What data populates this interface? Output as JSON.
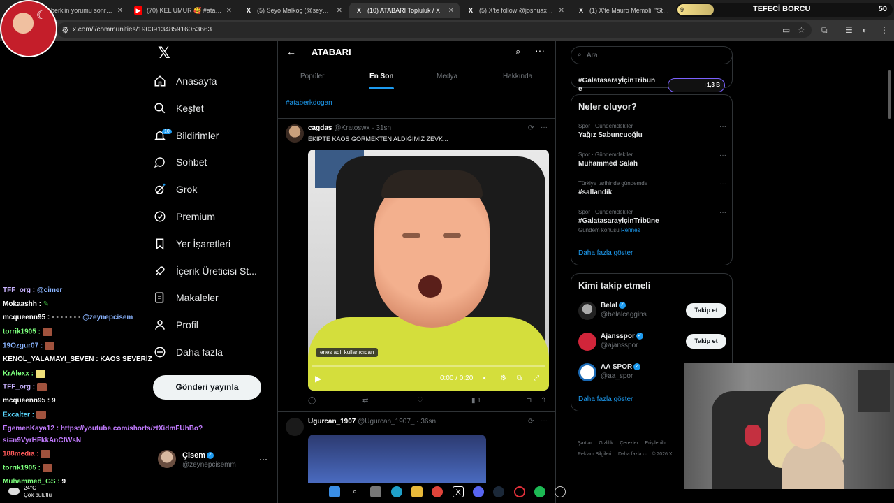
{
  "browser": {
    "tabs": [
      {
        "title": "aberk'in yorumu sonrası",
        "icon": "tab-favicon"
      },
      {
        "title": "(70) KEL UMUR 🥰 #ataberkdo",
        "icon": "youtube-icon"
      },
      {
        "title": "(5) Seyo Malkoç (@seyooo06) /",
        "icon": "x-icon"
      },
      {
        "title": "(10) ATABARI Topluluk / X",
        "icon": "x-icon"
      },
      {
        "title": "(5) X'te follow @joshuaxonsy: \"",
        "icon": "x-icon"
      },
      {
        "title": "(1) X'te Mauro Memoli: \"Star af",
        "icon": "x-icon"
      }
    ],
    "url": "x.com/i/communities/1903913485916053663"
  },
  "stream_overlay": {
    "goal_label": "TEFECİ BORCU",
    "goal_value": "50",
    "goal_pill": "9"
  },
  "nav": {
    "items": [
      {
        "label": "Anasayfa",
        "icon": "home-icon"
      },
      {
        "label": "Keşfet",
        "icon": "search-icon"
      },
      {
        "label": "Bildirimler",
        "icon": "bell-icon",
        "badge": "10"
      },
      {
        "label": "Sohbet",
        "icon": "chat-icon"
      },
      {
        "label": "Grok",
        "icon": "grok-icon"
      },
      {
        "label": "Premium",
        "icon": "premium-icon"
      },
      {
        "label": "Yer İşaretleri",
        "icon": "bookmark-icon"
      },
      {
        "label": "İçerik Üreticisi St...",
        "icon": "rocket-icon"
      },
      {
        "label": "Makaleler",
        "icon": "article-icon"
      },
      {
        "label": "Profil",
        "icon": "profile-icon"
      },
      {
        "label": "Daha fazla",
        "icon": "more-icon"
      }
    ],
    "post_button": "Gönderi yayınla",
    "user": {
      "name": "Çisem",
      "handle": "@zeynepcisemm"
    }
  },
  "chat": [
    {
      "user": "TFF_org :",
      "text": "@cimer",
      "color": "#c9b3ff"
    },
    {
      "user": "Mokaashh :",
      "text": "",
      "color": "#ffffff"
    },
    {
      "user": "mcqueenn95 :",
      "text": "@zeynepcisem",
      "color": "#ffffff"
    },
    {
      "user": "torrik1905 :",
      "text": "",
      "color": "#7cff7c"
    },
    {
      "user": "19Ozgur07 :",
      "text": "",
      "color": "#8ab4ff"
    },
    {
      "user": "KENOL_YALAMAYI_SEVEN :",
      "text": "KAOS SEVERİZ",
      "color": "#ffffff"
    },
    {
      "user": "KrAlexx :",
      "text": "",
      "color": "#7cff7c"
    },
    {
      "user": "TFF_org :",
      "text": "",
      "color": "#c9b3ff"
    },
    {
      "user": "mcqueenn95 :",
      "text": "9",
      "color": "#ffffff"
    },
    {
      "user": "Excalter :",
      "text": "",
      "color": "#5ad7ff"
    },
    {
      "user": "EgemenKaya12 :",
      "text": "https://youtube.com/shorts/ztXidmFUhBo?",
      "color": "#c27bff"
    },
    {
      "user": "",
      "text": "si=n9VyrHFkkAnCfWsN",
      "color": "#c27bff"
    },
    {
      "user": "188media :",
      "text": "",
      "color": "#ff5a5a"
    },
    {
      "user": "torrik1905 :",
      "text": "",
      "color": "#7cff7c"
    },
    {
      "user": "Muhammed_GS :",
      "text": "9",
      "color": "#7cff7c"
    }
  ],
  "weather": {
    "temp": "24°C",
    "desc": "Çok bulutlu"
  },
  "community": {
    "title": "ATABARI",
    "tabs": [
      "Popüler",
      "En Son",
      "Medya",
      "Hakkında"
    ],
    "hashtag": "#ataberkdogan"
  },
  "tweets": [
    {
      "name": "cagdas",
      "handle": "@Kratoswx",
      "time": "· 31sn",
      "text": "EKİPTE KAOS GÖRMEKTEN ALDIĞIMIZ ZEVK...",
      "video": {
        "caption": "enes adlı kullanıcıdan",
        "time": "0:00 / 0:20"
      },
      "views": "1"
    },
    {
      "name": "Ugurcan_1907",
      "handle": "@Ugurcan_1907_",
      "time": "· 36sn"
    }
  ],
  "right": {
    "search_placeholder": "Ara",
    "top_card": {
      "text": "#GalatasarayİçinTribun e",
      "count": "+1,3 B"
    },
    "trends_title": "Neler oluyor?",
    "trends": [
      {
        "category": "Spor · Gündemdekiler",
        "name": "Yağız Sabuncuoğlu",
        "extra": ""
      },
      {
        "category": "Spor · Gündemdekiler",
        "name": "Muhammed Salah",
        "extra": ""
      },
      {
        "category": "Türkiye tarihinde gündemde",
        "name": "#sallandik",
        "extra": ""
      },
      {
        "category": "Spor · Gündemdekiler",
        "name": "#GalatasarayİçinTribüne",
        "extra": "Gündem konusu",
        "extra_link": "Rennes"
      }
    ],
    "trends_more": "Daha fazla göster",
    "follow_title": "Kimi takip etmeli",
    "follow": [
      {
        "name": "Belal",
        "handle": "@belalcaggins",
        "button": "Takip et"
      },
      {
        "name": "Ajansspor",
        "handle": "@ajansspor",
        "button": "Takip et"
      },
      {
        "name": "AA SPOR",
        "handle": "@aa_spor",
        "button": ""
      }
    ],
    "follow_more": "Daha fazla göster",
    "footer": {
      "line1": [
        "Şartlar",
        "Gizlilik",
        "Çerezler",
        "Erişilebilir"
      ],
      "line2": [
        "Reklam Bilgileri",
        "Daha fazla ···",
        "© 2026 X"
      ]
    }
  },
  "colors": {
    "accent": "#1d9bf0",
    "bg": "#000000",
    "border": "#2f3336",
    "muted": "#71767b"
  }
}
